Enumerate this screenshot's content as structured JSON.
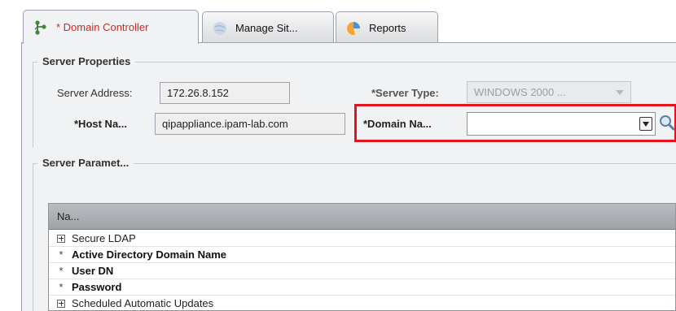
{
  "tabs": [
    {
      "label": "* Domain Controller",
      "icon": "network-tree-icon",
      "active": true
    },
    {
      "label": "Manage Sit...",
      "icon": "globe-icon",
      "active": false
    },
    {
      "label": "Reports",
      "icon": "pie-chart-icon",
      "active": false
    }
  ],
  "server_properties": {
    "title": "Server Properties",
    "server_address_label": "Server Address:",
    "server_address_value": "172.26.8.152",
    "server_type_label": "*Server Type:",
    "server_type_value": "WINDOWS 2000 ...",
    "host_name_label": "*Host Na...",
    "host_name_value": "qipappliance.ipam-lab.com",
    "domain_name_label": "*Domain Na...",
    "domain_name_value": "",
    "highlight_color": "#e4141b"
  },
  "server_parameters": {
    "title": "Server Paramet...",
    "column_header": "Na...",
    "rows": [
      {
        "marker": "plus",
        "label": "Secure LDAP"
      },
      {
        "marker": "*",
        "label": "Active Directory Domain Name"
      },
      {
        "marker": "*",
        "label": "User DN"
      },
      {
        "marker": "*",
        "label": "Password"
      },
      {
        "marker": "plus",
        "label": "Scheduled Automatic Updates"
      }
    ]
  }
}
